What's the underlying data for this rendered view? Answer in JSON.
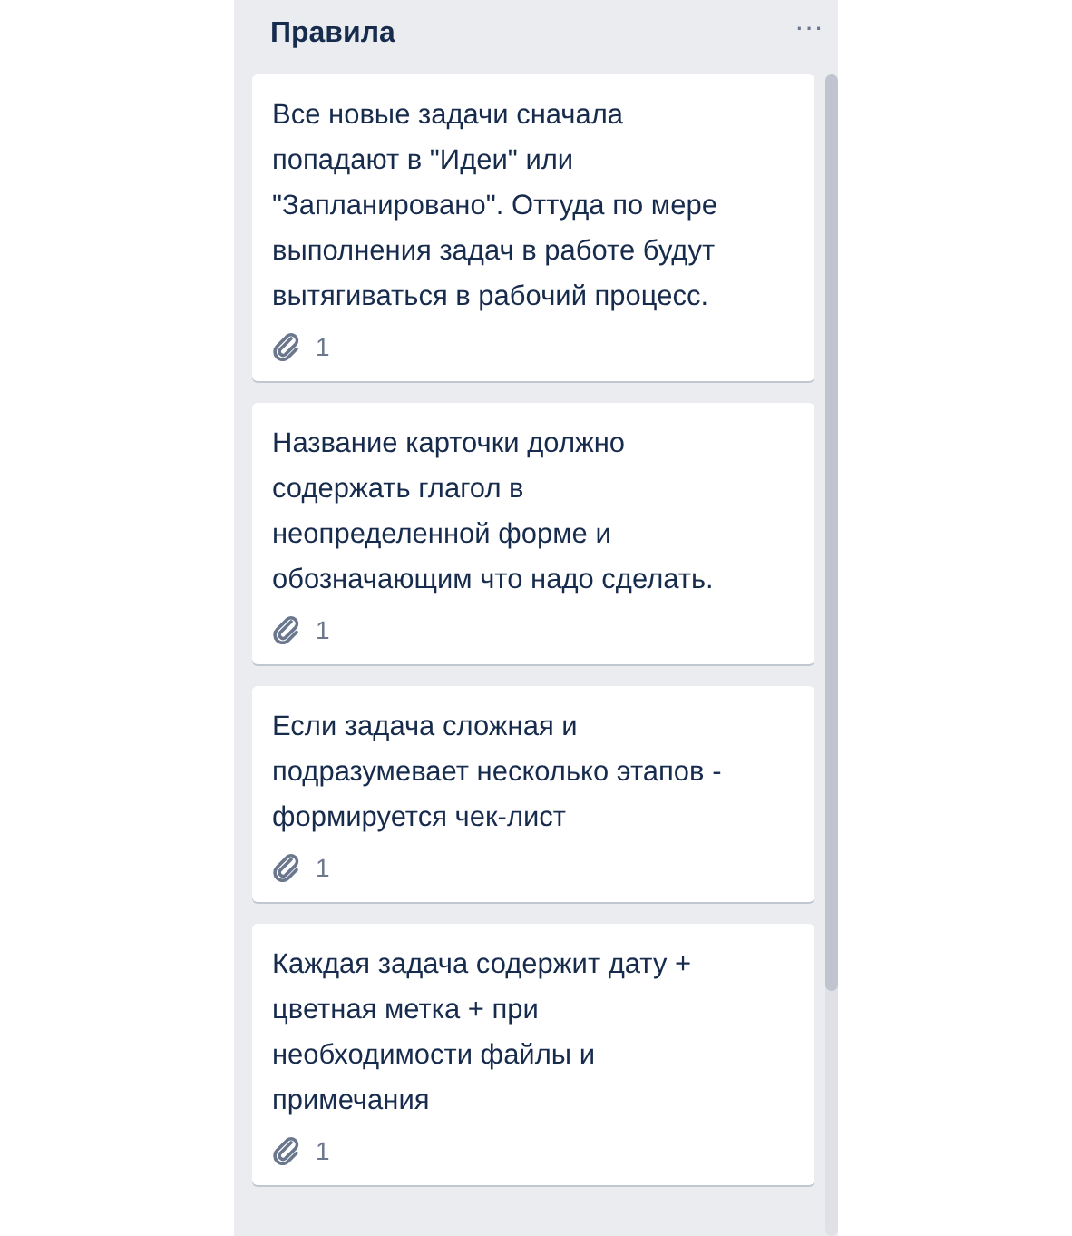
{
  "list": {
    "title": "Правила",
    "menu_icon": "···",
    "cards": [
      {
        "lines": [
          "Все новые задачи сначала",
          "попадают в \"Идеи\" или",
          "\"Запланировано\". Оттуда по мере",
          "выполнения задач в работе будут",
          "вытягиваться в рабочий процесс."
        ],
        "attachments": "1"
      },
      {
        "lines": [
          "Название карточки должно",
          "содержать глагол в",
          "неопределенной форме и",
          "обозначающим что надо сделать."
        ],
        "attachments": "1"
      },
      {
        "lines": [
          "Если задача сложная и",
          "подразумевает несколько этапов -",
          "формируется чек-лист"
        ],
        "attachments": "1"
      },
      {
        "lines": [
          "Каждая задача содержит дату +",
          "цветная метка + при",
          "необходимости файлы и",
          "примечания"
        ],
        "attachments": "1"
      }
    ]
  }
}
